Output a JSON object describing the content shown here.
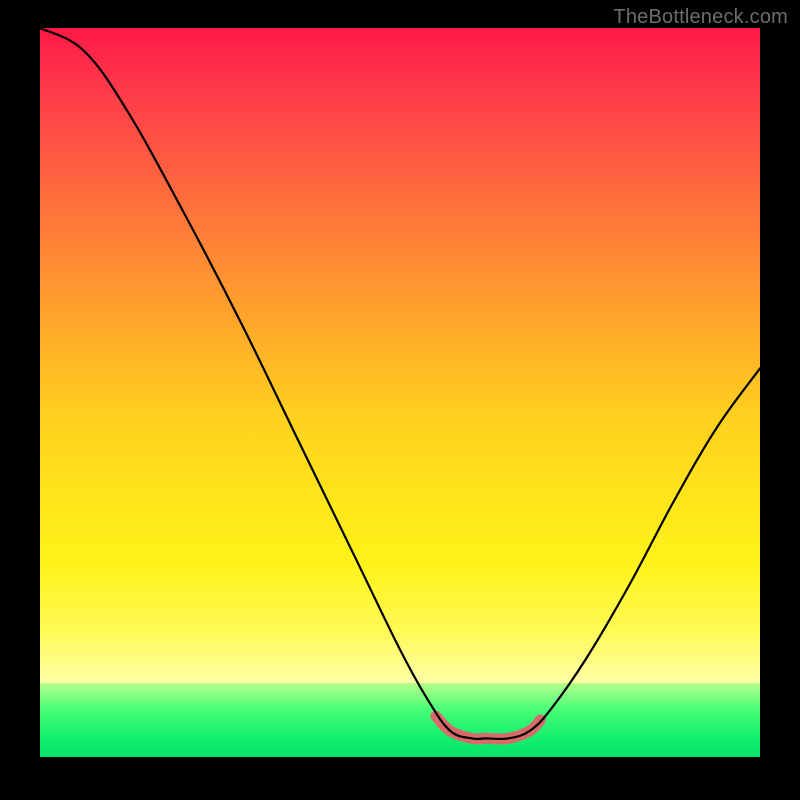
{
  "watermark": "TheBottleneck.com",
  "chart_data": {
    "type": "line",
    "title": "",
    "xlabel": "",
    "ylabel": "",
    "xlim": [
      0,
      100
    ],
    "ylim": [
      0,
      100
    ],
    "grid": false,
    "legend": false,
    "series": [
      {
        "name": "bottleneck-curve",
        "data": [
          {
            "x": 0,
            "y": 100
          },
          {
            "x": 6,
            "y": 97
          },
          {
            "x": 12,
            "y": 89
          },
          {
            "x": 20,
            "y": 75
          },
          {
            "x": 28,
            "y": 60
          },
          {
            "x": 36,
            "y": 44
          },
          {
            "x": 44,
            "y": 28
          },
          {
            "x": 50,
            "y": 16
          },
          {
            "x": 54,
            "y": 9
          },
          {
            "x": 57,
            "y": 5
          },
          {
            "x": 60,
            "y": 4
          },
          {
            "x": 62,
            "y": 4
          },
          {
            "x": 65,
            "y": 4
          },
          {
            "x": 68,
            "y": 5
          },
          {
            "x": 71,
            "y": 8
          },
          {
            "x": 76,
            "y": 15
          },
          {
            "x": 82,
            "y": 25
          },
          {
            "x": 88,
            "y": 36
          },
          {
            "x": 94,
            "y": 46
          },
          {
            "x": 100,
            "y": 54
          }
        ]
      },
      {
        "name": "optimal-region",
        "data": [
          {
            "x": 55,
            "y": 7
          },
          {
            "x": 57,
            "y": 5
          },
          {
            "x": 60,
            "y": 4
          },
          {
            "x": 62,
            "y": 4
          },
          {
            "x": 65,
            "y": 4
          },
          {
            "x": 68,
            "y": 5
          },
          {
            "x": 69.5,
            "y": 6.5
          }
        ]
      }
    ],
    "background_gradient_stops": [
      {
        "pos": 0.0,
        "color": "#ff1845"
      },
      {
        "pos": 0.25,
        "color": "#ff6a3d"
      },
      {
        "pos": 0.5,
        "color": "#ffb027"
      },
      {
        "pos": 0.75,
        "color": "#ffe51a"
      },
      {
        "pos": 0.885,
        "color": "#ffffa6"
      },
      {
        "pos": 0.92,
        "color": "#4cff78"
      },
      {
        "pos": 0.985,
        "color": "#06e46a"
      }
    ]
  }
}
